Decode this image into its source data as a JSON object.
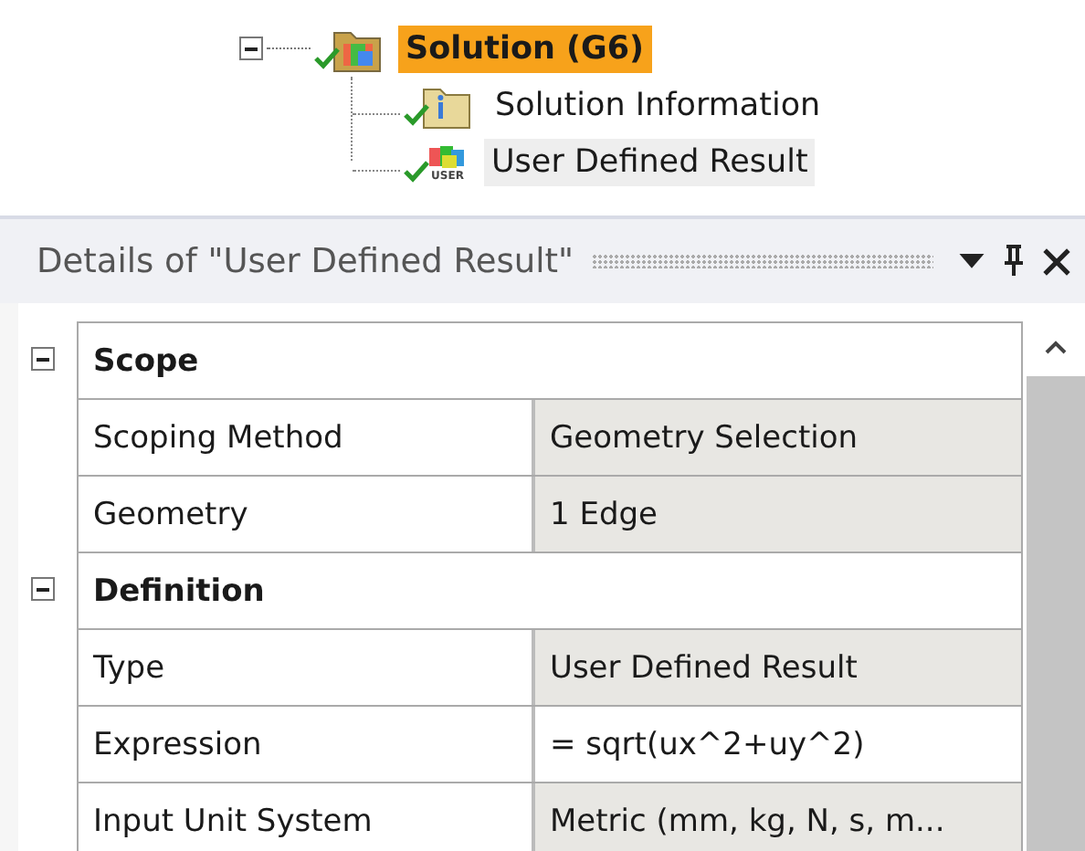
{
  "tree": {
    "label": "Solution (G6)",
    "kind": "solution",
    "solved": true,
    "expanded": true,
    "selected": true,
    "hovered": false,
    "children": [
      {
        "label": "Solution Information",
        "kind": "info",
        "solved": true,
        "selected": false,
        "hovered": false
      },
      {
        "label": "User Defined Result",
        "kind": "user",
        "icon_label": "USER",
        "solved": true,
        "selected": false,
        "hovered": true
      }
    ]
  },
  "details": {
    "title": "Details of \"User Defined Result\"",
    "sections": [
      {
        "title": "Scope",
        "expanded": true,
        "rows": [
          {
            "label": "Scoping Method",
            "value": "Geometry Selection",
            "editable": false
          },
          {
            "label": "Geometry",
            "value": "1 Edge",
            "editable": false
          }
        ]
      },
      {
        "title": "Definition",
        "expanded": true,
        "rows": [
          {
            "label": "Type",
            "value": "User Defined Result",
            "editable": false
          },
          {
            "label": "Expression",
            "value": "= sqrt(ux^2+uy^2)",
            "editable": true
          },
          {
            "label": "Input Unit System",
            "value": "Metric (mm, kg, N, s, m...",
            "editable": false
          }
        ]
      }
    ]
  }
}
